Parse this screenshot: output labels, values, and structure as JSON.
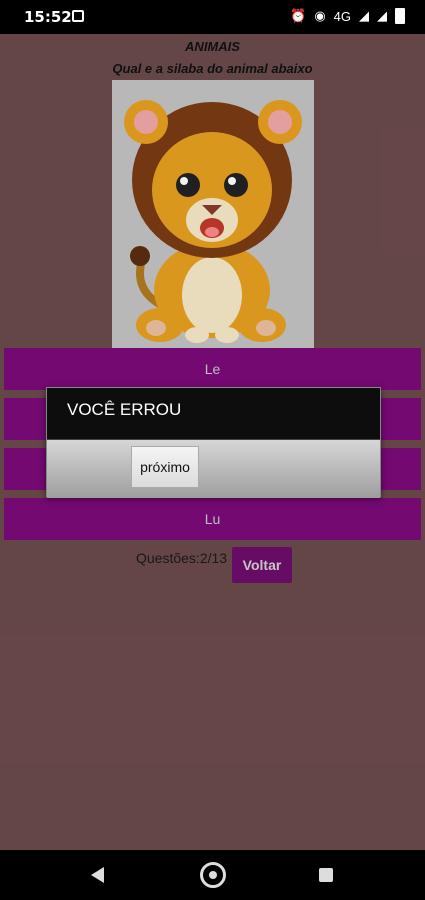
{
  "status": {
    "time": "15:52",
    "network": "4G"
  },
  "header": {
    "title": "ANIMAIS",
    "subtitle": "Qual e a silaba do animal abaixo"
  },
  "image": {
    "icon": "lion-cartoon"
  },
  "options": [
    {
      "label": "Le"
    },
    {
      "label": ""
    },
    {
      "label": ""
    },
    {
      "label": "Lu"
    }
  ],
  "footer": {
    "questions": "Questões:2/13",
    "back_label": "Voltar"
  },
  "dialog": {
    "title": "VOCÊ ERROU",
    "button_label": "próximo"
  },
  "colors": {
    "background": "#6b4a4a",
    "option": "#7a0a78",
    "button": "#6d0d6a"
  }
}
